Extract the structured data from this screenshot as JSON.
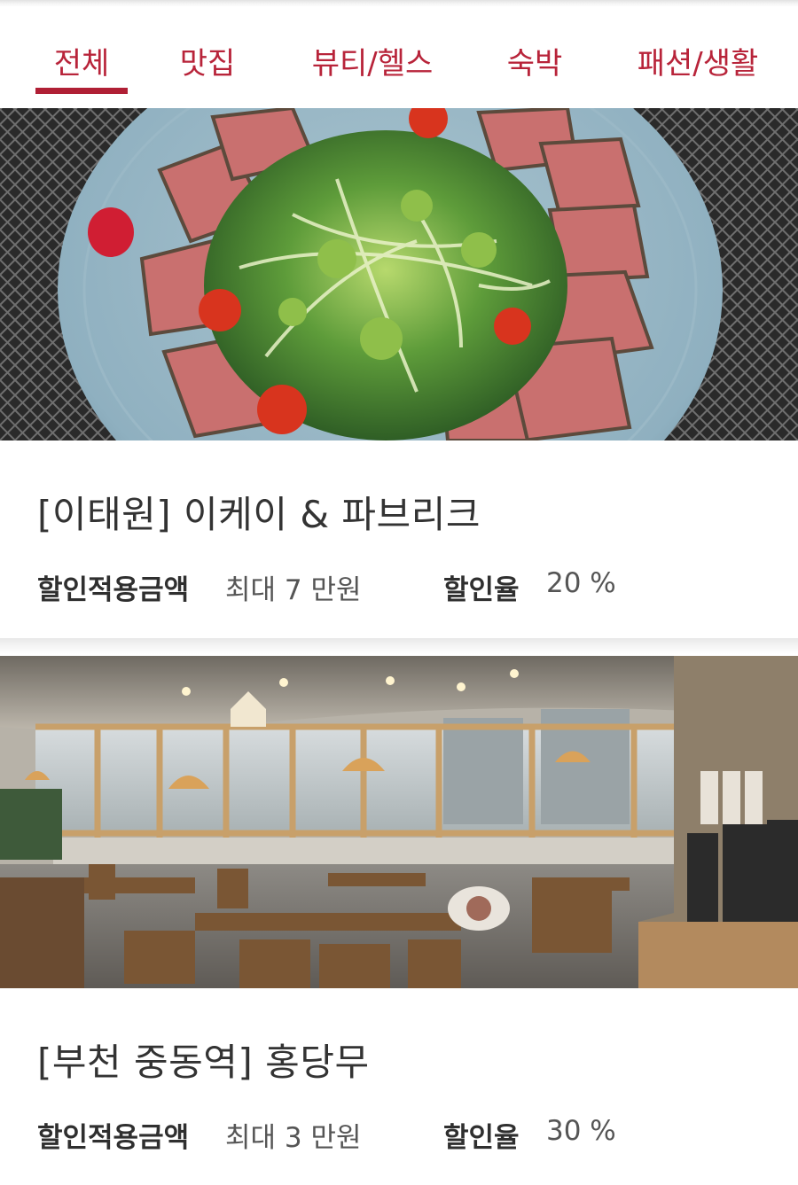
{
  "tabs": [
    {
      "label": "전체",
      "active": true
    },
    {
      "label": "맛집",
      "active": false
    },
    {
      "label": "뷰티/헬스",
      "active": false
    },
    {
      "label": "숙박",
      "active": false
    },
    {
      "label": "패션/생활",
      "active": false
    }
  ],
  "colors": {
    "accent": "#b01f35",
    "tab_text": "#b8243a",
    "title_text": "#333333"
  },
  "listings": [
    {
      "title": "[이태원] 이케이 & 파브리크",
      "amount_label": "할인적용금액",
      "amount_value": "최대 7 만원",
      "rate_label": "할인율",
      "rate_value": "20 %",
      "image": "salad-plate-photo"
    },
    {
      "title": "[부천 중동역] 홍당무",
      "amount_label": "할인적용금액",
      "amount_value": "최대 3 만원",
      "rate_label": "할인율",
      "rate_value": "30 %",
      "image": "restaurant-interior-photo"
    }
  ]
}
